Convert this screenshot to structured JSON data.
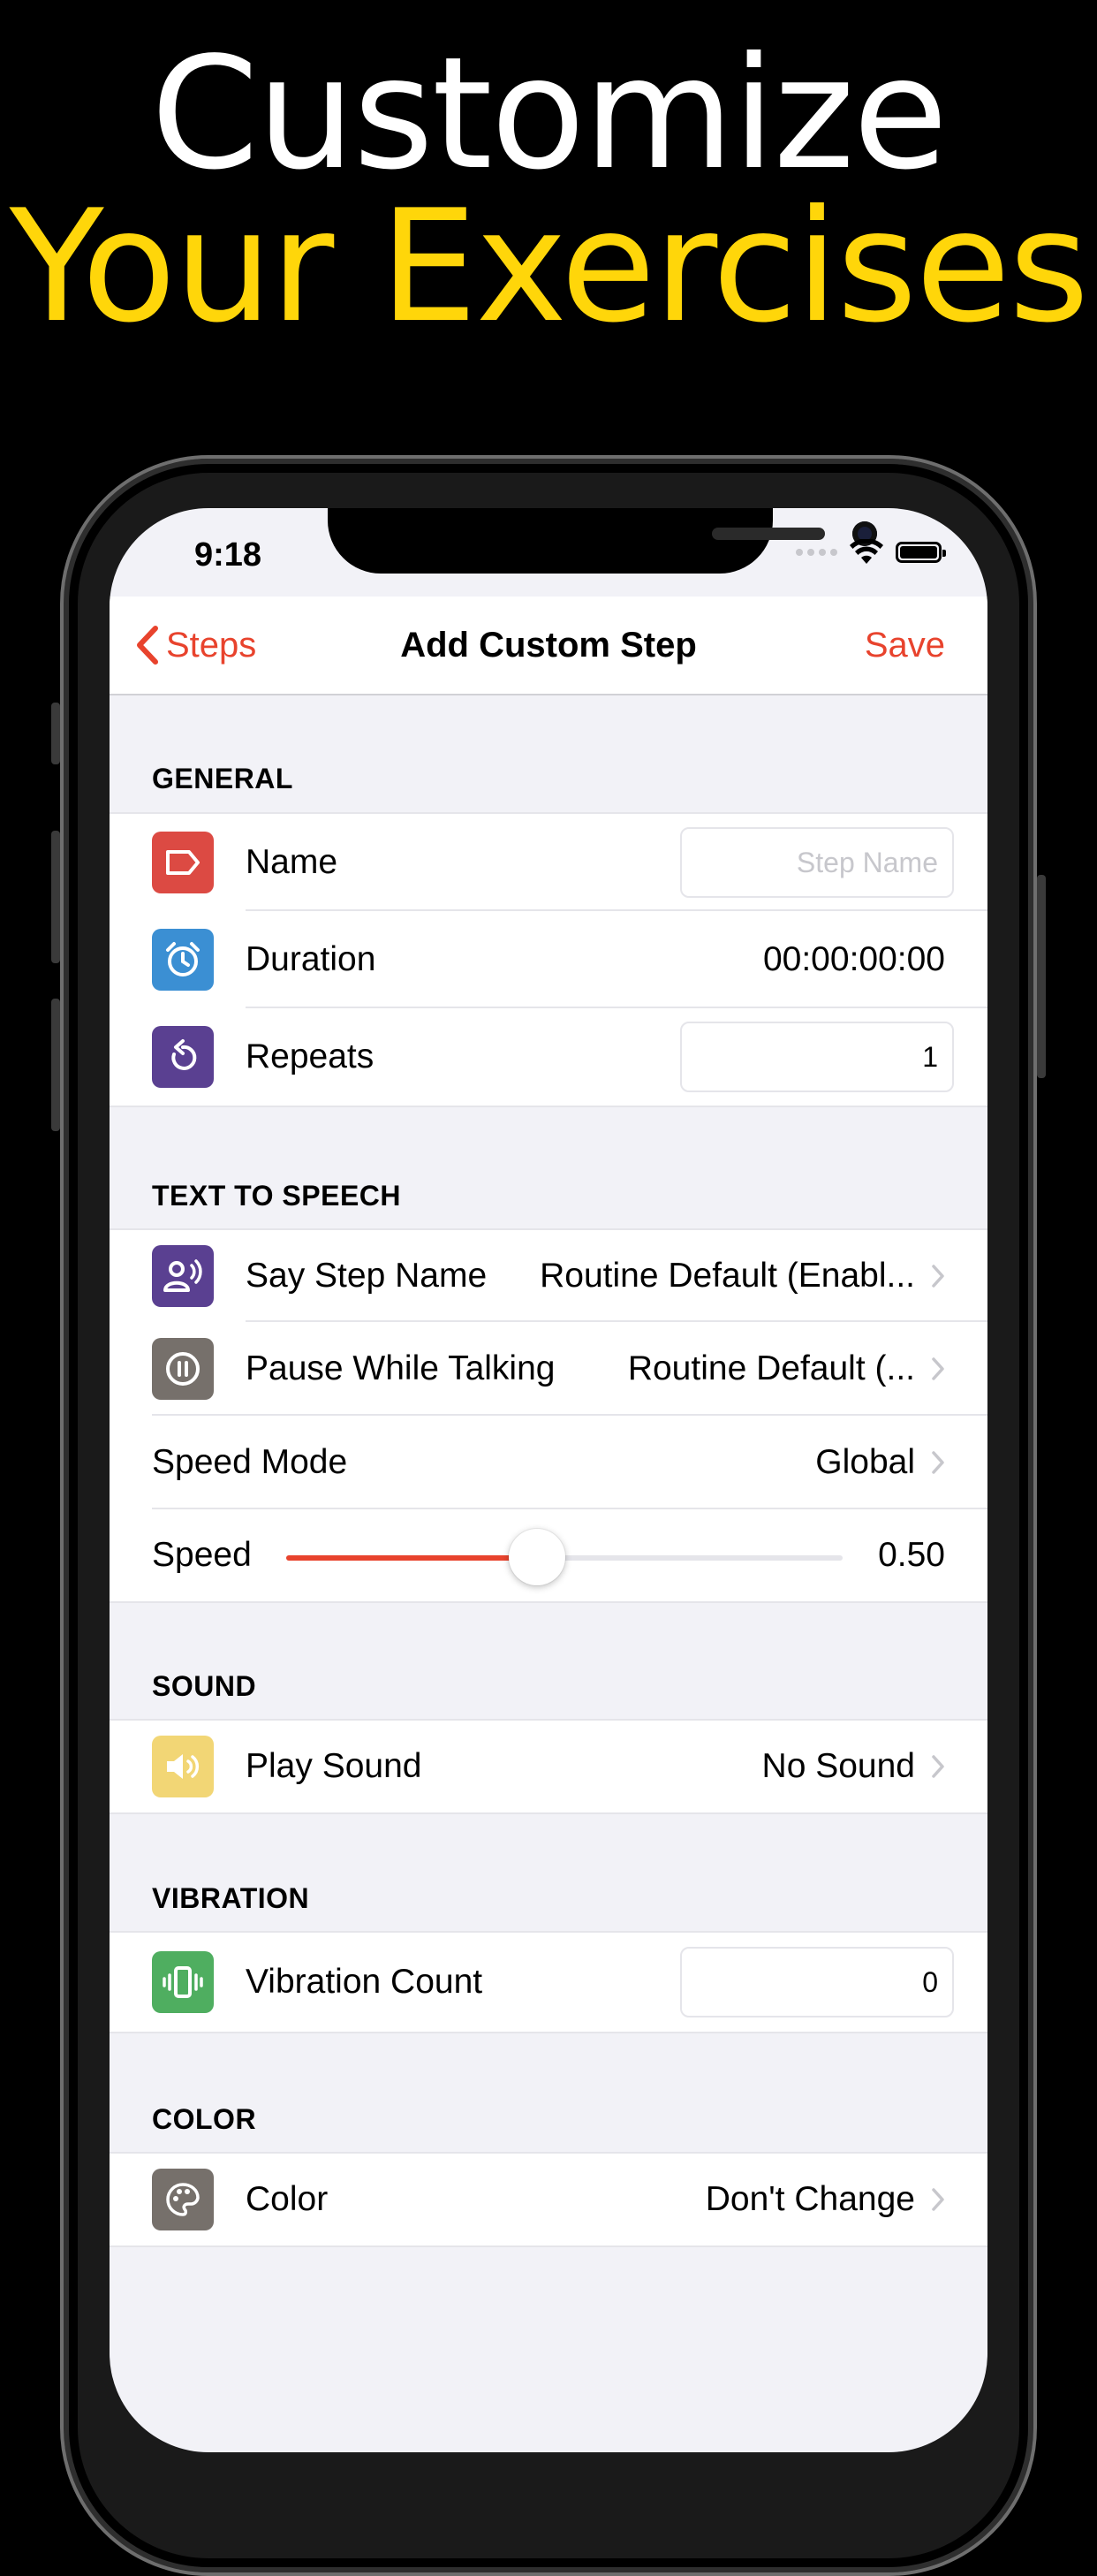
{
  "headline": {
    "line1": "Customize",
    "line2": "Your Exercises"
  },
  "status_bar": {
    "time": "9:18"
  },
  "navbar": {
    "back_label": "Steps",
    "title": "Add Custom Step",
    "save_label": "Save"
  },
  "sections": {
    "general": {
      "header": "GENERAL",
      "name_label": "Name",
      "name_placeholder": "Step Name",
      "duration_label": "Duration",
      "duration_value": "00:00:00:00",
      "repeats_label": "Repeats",
      "repeats_value": "1"
    },
    "tts": {
      "header": "TEXT TO SPEECH",
      "say_name_label": "Say Step Name",
      "say_name_value": "Routine Default (Enabl...",
      "pause_label": "Pause While Talking",
      "pause_value": "Routine Default (...",
      "speed_mode_label": "Speed Mode",
      "speed_mode_value": "Global",
      "speed_label": "Speed",
      "speed_value": "0.50",
      "speed_fraction": 0.45
    },
    "sound": {
      "header": "SOUND",
      "play_label": "Play Sound",
      "play_value": "No Sound"
    },
    "vibration": {
      "header": "VIBRATION",
      "count_label": "Vibration Count",
      "count_value": "0"
    },
    "color": {
      "header": "COLOR",
      "label": "Color",
      "value": "Don't Change"
    }
  },
  "colors": {
    "accent": "#E8432D",
    "headline_yellow": "#FFD60A",
    "name_icon": "#DC4A43",
    "duration_icon": "#3B8FD3",
    "repeats_icon": "#5A4091",
    "say_icon": "#5A4091",
    "pause_icon": "#76706B",
    "sound_icon": "#F2D675",
    "vibration_icon": "#4FAE60",
    "color_icon": "#76706B"
  },
  "icons": {
    "name": "tag-icon",
    "duration": "alarm-clock-icon",
    "repeats": "repeat-arrow-icon",
    "say": "speaking-person-icon",
    "pause": "pause-circle-icon",
    "sound": "speaker-icon",
    "vibration": "vibration-icon",
    "color": "palette-icon"
  }
}
